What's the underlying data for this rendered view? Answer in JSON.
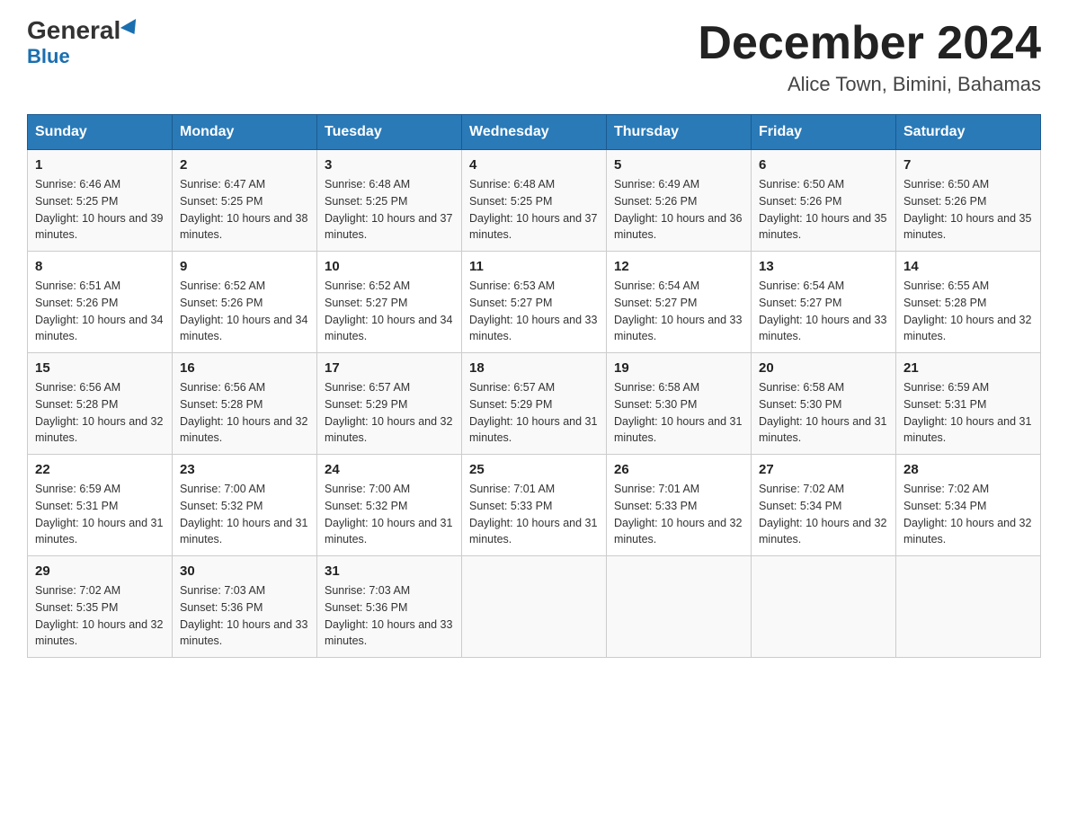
{
  "logo": {
    "general": "General",
    "blue": "Blue"
  },
  "title": "December 2024",
  "subtitle": "Alice Town, Bimini, Bahamas",
  "days_of_week": [
    "Sunday",
    "Monday",
    "Tuesday",
    "Wednesday",
    "Thursday",
    "Friday",
    "Saturday"
  ],
  "weeks": [
    [
      {
        "day": "1",
        "sunrise": "6:46 AM",
        "sunset": "5:25 PM",
        "daylight": "10 hours and 39 minutes."
      },
      {
        "day": "2",
        "sunrise": "6:47 AM",
        "sunset": "5:25 PM",
        "daylight": "10 hours and 38 minutes."
      },
      {
        "day": "3",
        "sunrise": "6:48 AM",
        "sunset": "5:25 PM",
        "daylight": "10 hours and 37 minutes."
      },
      {
        "day": "4",
        "sunrise": "6:48 AM",
        "sunset": "5:25 PM",
        "daylight": "10 hours and 37 minutes."
      },
      {
        "day": "5",
        "sunrise": "6:49 AM",
        "sunset": "5:26 PM",
        "daylight": "10 hours and 36 minutes."
      },
      {
        "day": "6",
        "sunrise": "6:50 AM",
        "sunset": "5:26 PM",
        "daylight": "10 hours and 35 minutes."
      },
      {
        "day": "7",
        "sunrise": "6:50 AM",
        "sunset": "5:26 PM",
        "daylight": "10 hours and 35 minutes."
      }
    ],
    [
      {
        "day": "8",
        "sunrise": "6:51 AM",
        "sunset": "5:26 PM",
        "daylight": "10 hours and 34 minutes."
      },
      {
        "day": "9",
        "sunrise": "6:52 AM",
        "sunset": "5:26 PM",
        "daylight": "10 hours and 34 minutes."
      },
      {
        "day": "10",
        "sunrise": "6:52 AM",
        "sunset": "5:27 PM",
        "daylight": "10 hours and 34 minutes."
      },
      {
        "day": "11",
        "sunrise": "6:53 AM",
        "sunset": "5:27 PM",
        "daylight": "10 hours and 33 minutes."
      },
      {
        "day": "12",
        "sunrise": "6:54 AM",
        "sunset": "5:27 PM",
        "daylight": "10 hours and 33 minutes."
      },
      {
        "day": "13",
        "sunrise": "6:54 AM",
        "sunset": "5:27 PM",
        "daylight": "10 hours and 33 minutes."
      },
      {
        "day": "14",
        "sunrise": "6:55 AM",
        "sunset": "5:28 PM",
        "daylight": "10 hours and 32 minutes."
      }
    ],
    [
      {
        "day": "15",
        "sunrise": "6:56 AM",
        "sunset": "5:28 PM",
        "daylight": "10 hours and 32 minutes."
      },
      {
        "day": "16",
        "sunrise": "6:56 AM",
        "sunset": "5:28 PM",
        "daylight": "10 hours and 32 minutes."
      },
      {
        "day": "17",
        "sunrise": "6:57 AM",
        "sunset": "5:29 PM",
        "daylight": "10 hours and 32 minutes."
      },
      {
        "day": "18",
        "sunrise": "6:57 AM",
        "sunset": "5:29 PM",
        "daylight": "10 hours and 31 minutes."
      },
      {
        "day": "19",
        "sunrise": "6:58 AM",
        "sunset": "5:30 PM",
        "daylight": "10 hours and 31 minutes."
      },
      {
        "day": "20",
        "sunrise": "6:58 AM",
        "sunset": "5:30 PM",
        "daylight": "10 hours and 31 minutes."
      },
      {
        "day": "21",
        "sunrise": "6:59 AM",
        "sunset": "5:31 PM",
        "daylight": "10 hours and 31 minutes."
      }
    ],
    [
      {
        "day": "22",
        "sunrise": "6:59 AM",
        "sunset": "5:31 PM",
        "daylight": "10 hours and 31 minutes."
      },
      {
        "day": "23",
        "sunrise": "7:00 AM",
        "sunset": "5:32 PM",
        "daylight": "10 hours and 31 minutes."
      },
      {
        "day": "24",
        "sunrise": "7:00 AM",
        "sunset": "5:32 PM",
        "daylight": "10 hours and 31 minutes."
      },
      {
        "day": "25",
        "sunrise": "7:01 AM",
        "sunset": "5:33 PM",
        "daylight": "10 hours and 31 minutes."
      },
      {
        "day": "26",
        "sunrise": "7:01 AM",
        "sunset": "5:33 PM",
        "daylight": "10 hours and 32 minutes."
      },
      {
        "day": "27",
        "sunrise": "7:02 AM",
        "sunset": "5:34 PM",
        "daylight": "10 hours and 32 minutes."
      },
      {
        "day": "28",
        "sunrise": "7:02 AM",
        "sunset": "5:34 PM",
        "daylight": "10 hours and 32 minutes."
      }
    ],
    [
      {
        "day": "29",
        "sunrise": "7:02 AM",
        "sunset": "5:35 PM",
        "daylight": "10 hours and 32 minutes."
      },
      {
        "day": "30",
        "sunrise": "7:03 AM",
        "sunset": "5:36 PM",
        "daylight": "10 hours and 33 minutes."
      },
      {
        "day": "31",
        "sunrise": "7:03 AM",
        "sunset": "5:36 PM",
        "daylight": "10 hours and 33 minutes."
      },
      null,
      null,
      null,
      null
    ]
  ],
  "labels": {
    "sunrise_prefix": "Sunrise: ",
    "sunset_prefix": "Sunset: ",
    "daylight_prefix": "Daylight: "
  }
}
